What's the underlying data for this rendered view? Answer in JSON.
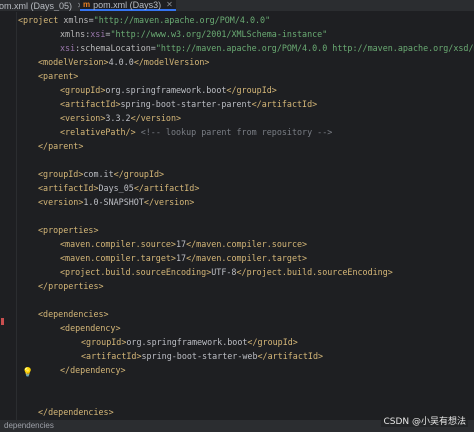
{
  "tabs": [
    {
      "label": "om.xml (Days_05)",
      "icon": "maven-m-icon",
      "active": false
    },
    {
      "label": "pom.xml (Days3)",
      "icon": "maven-m-icon",
      "active": true
    }
  ],
  "statusbar": {
    "breadcrumb": "dependencies"
  },
  "watermark": "CSDN @小吴有想法",
  "editor": {
    "lines": [
      "<project xmlns=\"http://maven.apache.org/POM/4.0.0\"",
      "xmlns:xsi=\"http://www.w3.org/2001/XMLSchema-instance\"",
      "xsi:schemaLocation=\"http://maven.apache.org/POM/4.0.0 http://maven.apache.org/xsd/m",
      "<modelVersion>4.0.0</modelVersion>",
      "<parent>",
      "<groupId>org.springframework.boot</groupId>",
      "<artifactId>spring-boot-starter-parent</artifactId>",
      "<version>3.3.2</version>",
      "<relativePath/> <!-- lookup parent from repository -->",
      "</parent>",
      "<groupId>com.it</groupId>",
      "<artifactId>Days_05</artifactId>",
      "<version>1.0-SNAPSHOT</version>",
      "<properties>",
      "<maven.compiler.source>17</maven.compiler.source>",
      "<maven.compiler.target>17</maven.compiler.target>",
      "<project.build.sourceEncoding>UTF-8</project.build.sourceEncoding>",
      "</properties>",
      "<dependencies>",
      "<dependency>",
      "<groupId>org.springframework.boot</groupId>",
      "<artifactId>spring-boot-starter-web</artifactId>",
      "</dependency>",
      "</dependencies>"
    ]
  }
}
